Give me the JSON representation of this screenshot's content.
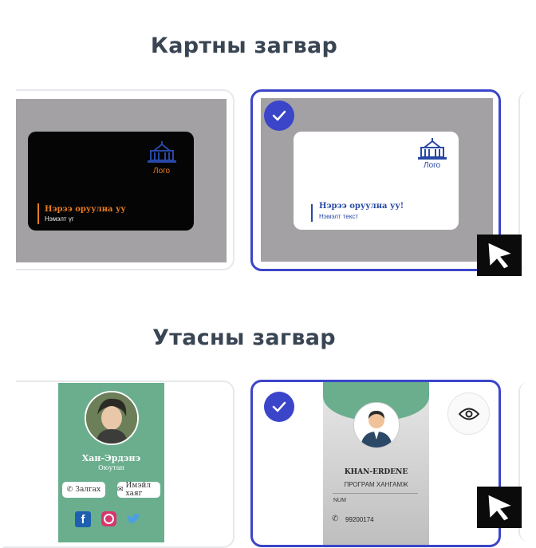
{
  "sections": {
    "card_title": "Картны загвар",
    "phone_title": "Утасны загвар"
  },
  "card_templates": [
    {
      "logo_label": "Лого",
      "name": "Нэрээ оруулна уу",
      "subtitle": "Нэмэлт үг",
      "theme": "dark"
    },
    {
      "logo_label": "Лого",
      "name": "Нэрээ оруулна уу!",
      "subtitle": "Нэмэлт текст",
      "theme": "light"
    }
  ],
  "phone_templates": [
    {
      "name": "Хан-Эрдэнэ",
      "role": "Оюутан",
      "call_button": "Залгах",
      "email_button": "Имэйл хаяг",
      "socials": [
        "facebook-icon",
        "instagram-icon",
        "twitter-icon"
      ]
    },
    {
      "name": "KHAN-ERDENE",
      "role": "ПРОГРАМ ХАНГАМЖ",
      "num_label": "NUM",
      "phone": "99200174"
    }
  ],
  "colors": {
    "accent": "#3b45c9",
    "gray_bg": "#a3a1a4",
    "green": "#6aae8e",
    "logo_blue": "#2748a6",
    "orange": "#e87b21"
  },
  "icons": [
    "check-icon",
    "cursor-icon",
    "eye-icon",
    "phone-icon",
    "email-icon",
    "logo-icon",
    "avatar"
  ]
}
